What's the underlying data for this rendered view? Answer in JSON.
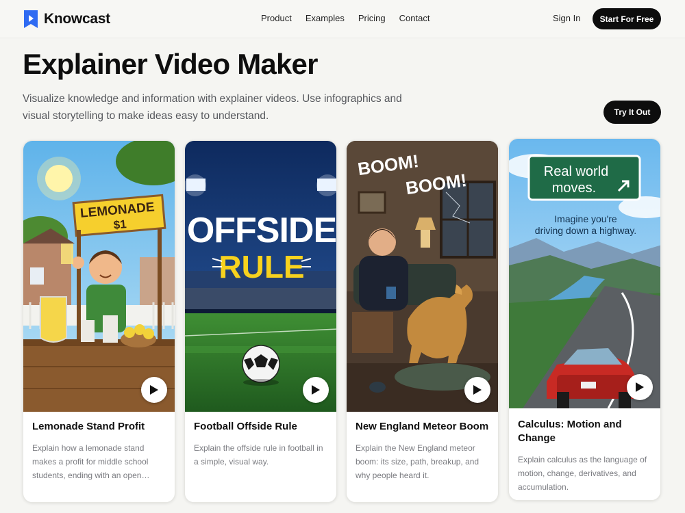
{
  "brand": {
    "name": "Knowcast",
    "accent": "#2f6bf2"
  },
  "nav": {
    "links": [
      "Product",
      "Examples",
      "Pricing",
      "Contact"
    ],
    "sign_in": "Sign In",
    "cta": "Start For Free"
  },
  "hero": {
    "title": "Explainer Video Maker",
    "subtitle": "Visualize knowledge and information with explainer videos. Use infographics and visual storytelling to make ideas easy to understand.",
    "cta": "Try It Out"
  },
  "cards": [
    {
      "title": "Lemonade Stand Profit",
      "desc": "Explain how a lemonade stand makes a profit for middle school students, ending with an open…",
      "thumb_text": [
        "LEMONADE",
        "$1"
      ]
    },
    {
      "title": "Football Offside Rule",
      "desc": "Explain the offside rule in football in a simple, visual way.",
      "thumb_text": [
        "OFFSIDE",
        "RULE"
      ]
    },
    {
      "title": "New England Meteor Boom",
      "desc": "Explain the New England meteor boom: its size, path, breakup, and why people heard it.",
      "thumb_text": [
        "BOOM!",
        "BOOM!"
      ]
    },
    {
      "title": "Calculus: Motion and Change",
      "desc": "Explain calculus as the language of motion, change, derivatives, and accumulation.",
      "thumb_text": [
        "Real world",
        "moves.",
        "Imagine you're",
        "driving down a highway."
      ]
    }
  ],
  "icons": {
    "play": "play-icon",
    "logo": "logo-play-icon",
    "arrow": "arrow-up-right-icon"
  }
}
